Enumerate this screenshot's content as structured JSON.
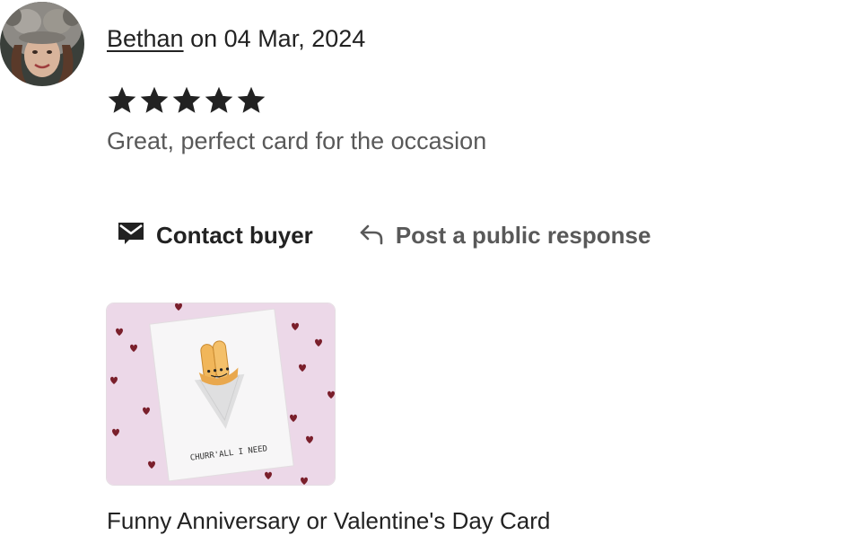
{
  "review": {
    "reviewer_name": "Bethan",
    "date_prefix": "on",
    "date": "04 Mar, 2024",
    "rating": 5,
    "rating_max": 5,
    "text": "Great, perfect card for the occasion"
  },
  "actions": {
    "contact_label": "Contact buyer",
    "contact_icon": "envelope-icon",
    "respond_label": "Post a public response",
    "respond_icon": "reply-arrow-icon"
  },
  "listing": {
    "card_text": "CHURR'ALL I NEED",
    "title": "Funny Anniversary or Valentine's Day Card"
  },
  "colors": {
    "primary_text": "#222222",
    "secondary_text": "#595959",
    "thumbnail_background": "#ecd8e8",
    "heart": "#7a1f2b"
  }
}
